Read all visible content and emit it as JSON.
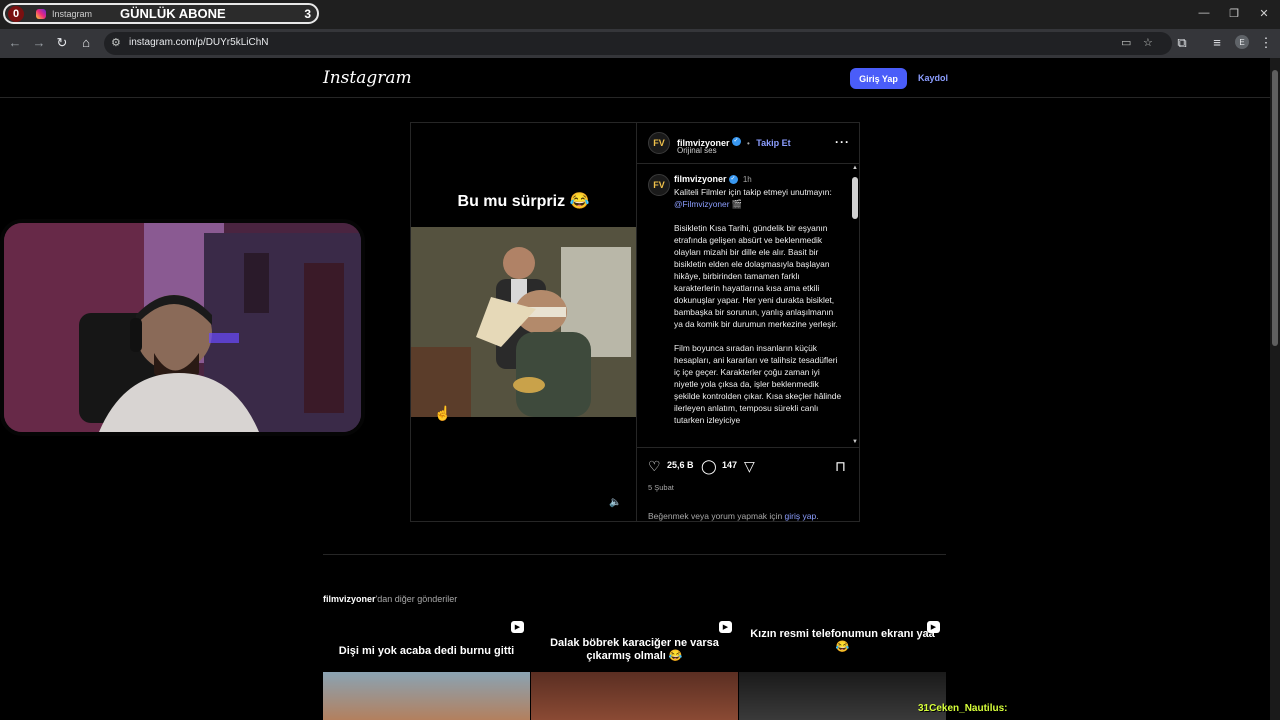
{
  "browser": {
    "tab": {
      "count_badge": "0",
      "title": "Instagram",
      "overlay_text": "GÜNLÜK ABONE",
      "overlay_count": "3"
    },
    "url": "instagram.com/p/DUYr5kLiChN",
    "profile_initial": "E",
    "window_controls": {
      "minimize": "—",
      "maximize": "❐",
      "close": "✕"
    }
  },
  "instagram": {
    "logo": "Instagram",
    "login_button": "Giriş Yap",
    "signup_link": "Kaydol"
  },
  "post": {
    "media_caption": "Bu mu sürpriz 😂",
    "header": {
      "username": "filmvizyoner",
      "separator": "•",
      "follow": "Takip Et",
      "audio": "Orijinal ses"
    },
    "caption": {
      "username": "filmvizyoner",
      "time": "1h",
      "intro": "Kaliteli Filmler için takip etmeyi unutmayın:",
      "mention": "@Filmvizyoner",
      "intro_emoji": "🎬",
      "paragraph1": "Bisikletin Kısa Tarihi, gündelik bir eşyanın etrafında gelişen absürt ve beklenmedik olayları mizahi bir dille ele alır. Basit bir bisikletin elden ele dolaşmasıyla başlayan hikâye, birbirinden tamamen farklı karakterlerin hayatlarına kısa ama etkili dokunuşlar yapar. Her yeni durakta bisiklet, bambaşka bir sorunun, yanlış anlaşılmanın ya da komik bir durumun merkezine yerleşir.",
      "paragraph2": "Film boyunca sıradan insanların küçük hesapları, ani kararları ve talihsiz tesadüfleri iç içe geçer. Karakterler çoğu zaman iyi niyetle yola çıksa da, işler beklenmedik şekilde kontrolden çıkar. Kısa skeçler hâlinde ilerleyen anlatım, temposu sürekli canlı tutarken izleyiciye"
    },
    "likes": "25,6 B",
    "comments": "147",
    "date": "5 Şubat",
    "login_note": "Beğenmek veya yorum yapmak için",
    "login_note_link": "giriş yap",
    "login_note_end": "."
  },
  "more_posts": {
    "username": "filmvizyoner",
    "label_suffix": "'dan diğer gönderiler",
    "items": [
      {
        "title": "Dişi mi yok acaba dedi burnu gitti"
      },
      {
        "title": "Dalak böbrek karaciğer ne varsa çıkarmış olmalı 😂"
      },
      {
        "title": "Kızın resmi telefonumun ekranı yaa 😂"
      }
    ]
  },
  "stream_overlay": {
    "chat_line": "31Ceken_Nautilus:"
  }
}
